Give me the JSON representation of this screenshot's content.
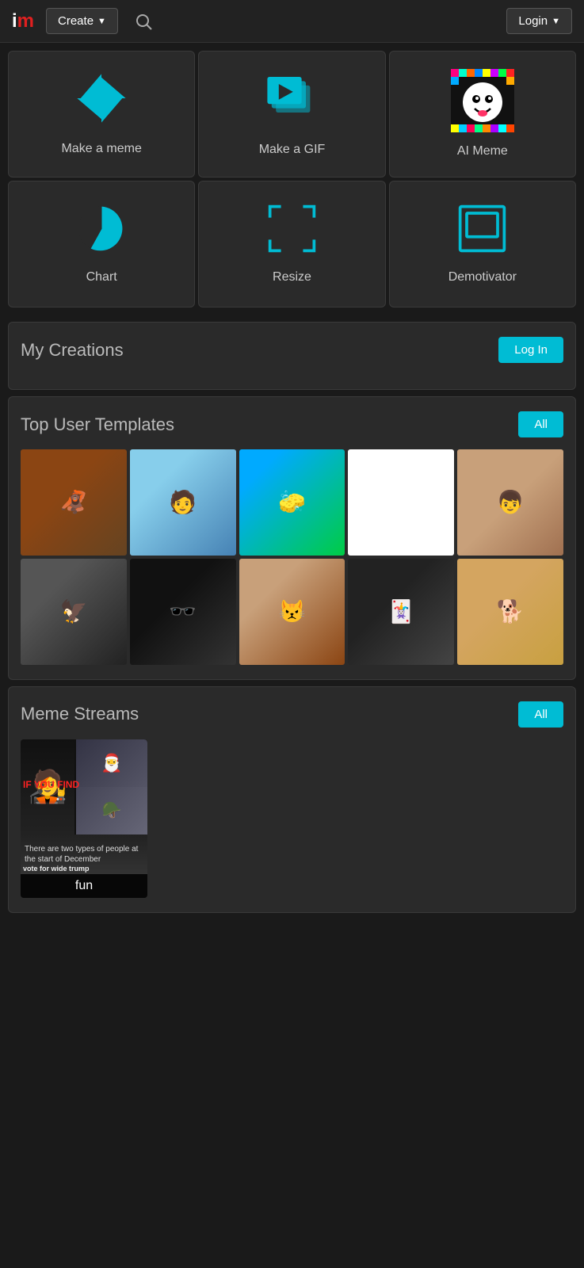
{
  "header": {
    "logo_i": "i",
    "logo_m": "m",
    "create_label": "Create",
    "login_label": "Login"
  },
  "tools": [
    {
      "id": "make-meme",
      "label": "Make a meme",
      "icon": "pinwheel"
    },
    {
      "id": "make-gif",
      "label": "Make a GIF",
      "icon": "gif"
    },
    {
      "id": "ai-meme",
      "label": "AI Meme",
      "icon": "ai"
    },
    {
      "id": "chart",
      "label": "Chart",
      "icon": "chart"
    },
    {
      "id": "resize",
      "label": "Resize",
      "icon": "resize"
    },
    {
      "id": "demotivator",
      "label": "Demotivator",
      "icon": "demotivator"
    }
  ],
  "my_creations": {
    "title": "My Creations",
    "login_label": "Log In"
  },
  "top_templates": {
    "title": "Top User Templates",
    "all_label": "All",
    "templates": [
      {
        "id": "t1",
        "emoji": "🦧"
      },
      {
        "id": "t2",
        "emoji": "🧑"
      },
      {
        "id": "t3",
        "emoji": "🧽"
      },
      {
        "id": "t4",
        "emoji": ""
      },
      {
        "id": "t5",
        "emoji": "👦"
      },
      {
        "id": "t6",
        "emoji": "🦅"
      },
      {
        "id": "t7",
        "emoji": "🕶️"
      },
      {
        "id": "t8",
        "emoji": "😾"
      },
      {
        "id": "t9",
        "emoji": "🃏"
      },
      {
        "id": "t10",
        "emoji": "🐕"
      }
    ]
  },
  "meme_streams": {
    "title": "Meme Streams",
    "all_label": "All",
    "streams": [
      {
        "id": "s1",
        "label": "fun",
        "red_text": "IF YOU FIND",
        "bottom_text": "vote for wide trump",
        "sub_text": "There are two types of people at the start of December"
      }
    ]
  },
  "accent_color": "#00bcd4"
}
